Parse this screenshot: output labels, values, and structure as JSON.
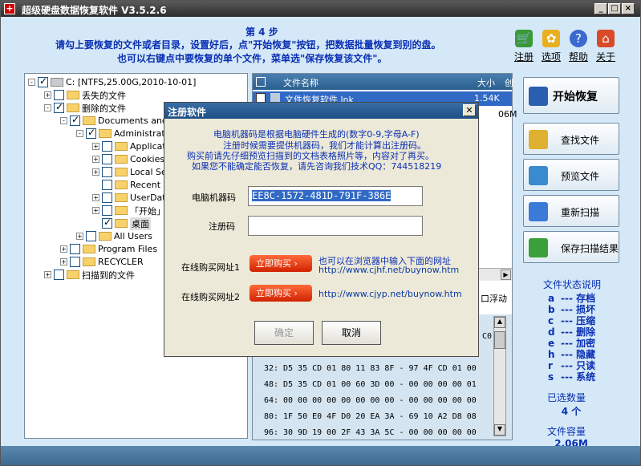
{
  "app": {
    "title": "超级硬盘数据恢复软件 V3.5.2.6"
  },
  "header": {
    "step": "第 4 步",
    "line1": "请勾上要恢复的文件或者目录，设置好后，点\"开始恢复\"按钮，把数据批量恢复到别的盘。",
    "line2": "也可以右键点中要恢复的单个文件，菜单选\"保存恢复该文件\"。"
  },
  "toolbar": [
    {
      "label": "注册",
      "icon": "cart-icon"
    },
    {
      "label": "选项",
      "icon": "gear-icon"
    },
    {
      "label": "帮助",
      "icon": "help-icon"
    },
    {
      "label": "关于",
      "icon": "home-icon"
    }
  ],
  "tree": [
    {
      "label": "C: [NTFS,25.00G,2010-10-01]",
      "level": 0,
      "checked": true,
      "expander": "-"
    },
    {
      "label": "丢失的文件",
      "level": 1,
      "checked": false,
      "expander": "+"
    },
    {
      "label": "删除的文件",
      "level": 1,
      "checked": true,
      "expander": "-"
    },
    {
      "label": "Documents and S",
      "level": 2,
      "checked": true,
      "expander": "-"
    },
    {
      "label": "Administrator",
      "level": 3,
      "checked": true,
      "expander": "-"
    },
    {
      "label": "Applicati",
      "level": 4,
      "checked": false,
      "expander": "+"
    },
    {
      "label": "Cookies",
      "level": 4,
      "checked": false,
      "expander": "+"
    },
    {
      "label": "Local Set",
      "level": 4,
      "checked": false,
      "expander": "+"
    },
    {
      "label": "Recent",
      "level": 4,
      "checked": false,
      "expander": ""
    },
    {
      "label": "UserData",
      "level": 4,
      "checked": false,
      "expander": "+"
    },
    {
      "label": "「开始」",
      "level": 4,
      "checked": false,
      "expander": "+"
    },
    {
      "label": "桌面",
      "level": 4,
      "checked": true,
      "expander": ""
    },
    {
      "label": "All Users",
      "level": 3,
      "checked": false,
      "expander": "+"
    },
    {
      "label": "Program Files",
      "level": 2,
      "checked": false,
      "expander": "+"
    },
    {
      "label": "RECYCLER",
      "level": 2,
      "checked": false,
      "expander": "+"
    },
    {
      "label": "扫描到的文件",
      "level": 1,
      "checked": false,
      "expander": "+"
    }
  ],
  "filelist": {
    "col_name": "文件名称",
    "col_size": "大小",
    "col_date": "创",
    "rows": [
      {
        "name": "文件恢复软件.lnk",
        "size": "1.54K"
      },
      {
        "name": "",
        "size": "06M"
      }
    ],
    "float_label": "口浮动"
  },
  "hex": {
    "rows": [
      {
        "offset": "32:",
        "bytes": "D5 35 CD 01 80 11 83 8F - 97 4F CD 01 00"
      },
      {
        "offset": "48:",
        "bytes": "D5 35 CD 01 00 60 3D 00 - 00 00 00 00 01"
      },
      {
        "offset": "64:",
        "bytes": "00 00 00 00 00 00 00 00 - 00 00 00 00 00"
      },
      {
        "offset": "80:",
        "bytes": "1F 50 E0 4F D0 20 EA 3A - 69 10 A2 D8 08"
      },
      {
        "offset": "96:",
        "bytes": "30 9D 19 00 2F 43 3A 5C - 00 00 00 00 00"
      }
    ],
    "side_top": "C0"
  },
  "actions": [
    {
      "label": "开始恢复",
      "icon": "disk-save-icon"
    },
    {
      "label": "查找文件",
      "icon": "folder-search-icon"
    },
    {
      "label": "预览文件",
      "icon": "magnifier-icon"
    },
    {
      "label": "重新扫描",
      "icon": "plus-icon"
    },
    {
      "label": "保存扫描结果",
      "icon": "save-arrow-icon"
    }
  ],
  "legend": {
    "title": "文件状态说明",
    "items": [
      {
        "k": "a",
        "v": "--- 存档"
      },
      {
        "k": "b",
        "v": "--- 损坏"
      },
      {
        "k": "c",
        "v": "--- 压缩"
      },
      {
        "k": "d",
        "v": "--- 删除"
      },
      {
        "k": "e",
        "v": "--- 加密"
      },
      {
        "k": "h",
        "v": "--- 隐藏"
      },
      {
        "k": "r",
        "v": "--- 只读"
      },
      {
        "k": "s",
        "v": "--- 系统"
      }
    ]
  },
  "selection": {
    "count_label": "已选数量",
    "count": "4 个",
    "size_label": "文件容量",
    "size": "2.06M"
  },
  "dialog": {
    "title": "注册软件",
    "info1": "电脑机器码是根据电脑硬件生成的(数字0-9,字母A-F)",
    "info2": "注册时候需要提供机器码，我们才能计算出注册码。",
    "info3": "购买前请先仔细预览扫描到的文档表格照片等，内容对了再买。",
    "info4": "如果您不能确定能否恢复，请先咨询我们技术QQ：744518219",
    "machine_label": "电脑机器码",
    "machine_code": "EE8C-1572-481D-791F-386E",
    "reg_label": "注册码",
    "reg_value": "",
    "buy1_label": "在线购买网址1",
    "buy2_label": "在线购买网址2",
    "buy_btn": "立即购买",
    "hint": "也可以在浏览器中输入下面的网址",
    "url1": "http://www.cjhf.net/buynow.htm",
    "url2": "http://www.cjyp.net/buynow.htm",
    "ok": "确定",
    "cancel": "取消"
  }
}
